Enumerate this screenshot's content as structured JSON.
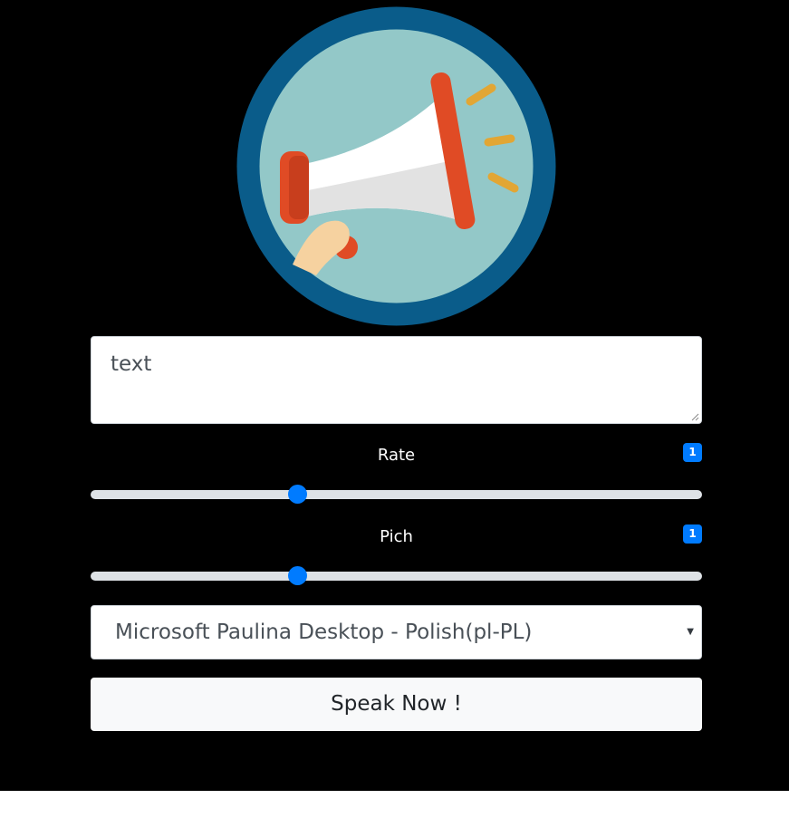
{
  "textarea": {
    "value": "text"
  },
  "rate": {
    "label": "Rate",
    "badge": "1",
    "value": 1,
    "min": 0,
    "max": 3
  },
  "pitch": {
    "label": "Pich",
    "badge": "1",
    "value": 1,
    "min": 0,
    "max": 3
  },
  "voice_select": {
    "selected": "Microsoft Paulina Desktop - Polish(pl-PL)"
  },
  "speak_button": {
    "label": "Speak Now !"
  },
  "logo": {
    "icon": "megaphone-icon"
  },
  "colors": {
    "accent": "#007bff",
    "background": "#000000",
    "logo_ring": "#0a5c8a",
    "logo_inner": "#93c8c8",
    "megaphone_red": "#e04b25"
  }
}
